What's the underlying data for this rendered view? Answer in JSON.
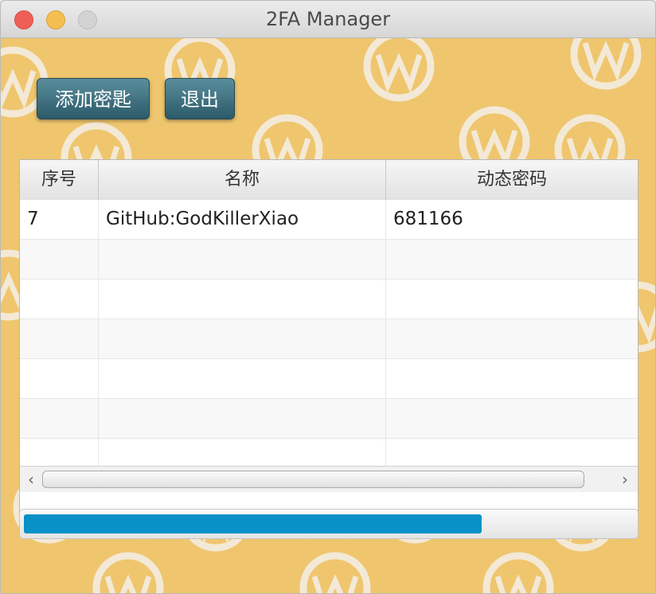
{
  "window": {
    "title": "2FA Manager"
  },
  "toolbar": {
    "add_key_label": "添加密匙",
    "exit_label": "退出"
  },
  "table": {
    "headers": [
      "序号",
      "名称",
      "动态密码"
    ],
    "rows": [
      [
        "7",
        "GitHub:GodKillerXiao",
        "681166"
      ]
    ]
  },
  "progress": {
    "value": 0.75,
    "color": "#0791c6"
  },
  "colors": {
    "background": "#efc66e",
    "button": "#2c5a69"
  },
  "icons": {
    "scroll_left": "chevron-left-icon",
    "scroll_right": "chevron-right-icon"
  }
}
